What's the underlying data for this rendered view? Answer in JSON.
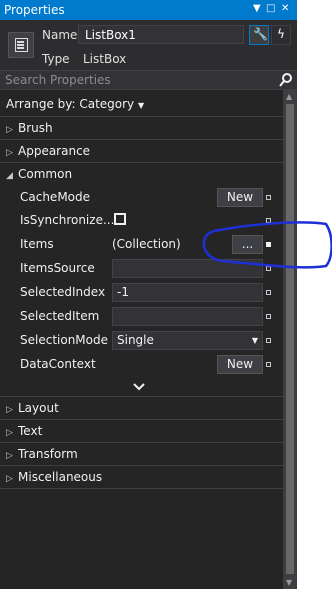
{
  "window": {
    "title": "Properties"
  },
  "object": {
    "name_label": "Name",
    "name_value": "ListBox1",
    "type_label": "Type",
    "type_value": "ListBox"
  },
  "search": {
    "placeholder": "Search Properties"
  },
  "arrange": {
    "label": "Arrange by: Category"
  },
  "categories_before": [
    {
      "label": "Brush"
    },
    {
      "label": "Appearance"
    }
  ],
  "common": {
    "label": "Common",
    "props": {
      "cachemode": {
        "name": "CacheMode",
        "button": "New"
      },
      "issync": {
        "name": "IsSynchronize..."
      },
      "items": {
        "name": "Items",
        "value": "(Collection)",
        "button": "..."
      },
      "itemssource": {
        "name": "ItemsSource",
        "value": ""
      },
      "selectedindex": {
        "name": "SelectedIndex",
        "value": "-1"
      },
      "selecteditem": {
        "name": "SelectedItem",
        "value": ""
      },
      "selectionmode": {
        "name": "SelectionMode",
        "value": "Single"
      },
      "datacontext": {
        "name": "DataContext",
        "button": "New"
      }
    }
  },
  "categories_after": [
    {
      "label": "Layout"
    },
    {
      "label": "Text"
    },
    {
      "label": "Transform"
    },
    {
      "label": "Miscellaneous"
    }
  ]
}
